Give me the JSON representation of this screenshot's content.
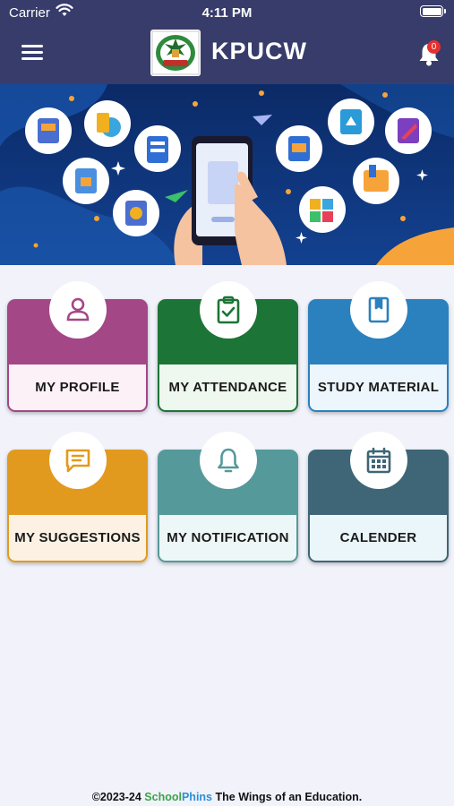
{
  "status_bar": {
    "carrier": "Carrier",
    "time": "4:11 PM"
  },
  "header": {
    "title": "KPUCW",
    "notification_count": "0",
    "menu_icon": "hamburger-menu-icon",
    "bell_icon": "bell-icon"
  },
  "colors": {
    "header_bg": "#373c6b",
    "banner_bg": "#0e2f6e",
    "page_bg": "#f1f2fa"
  },
  "tiles": [
    {
      "label": "MY PROFILE",
      "icon": "person-icon",
      "color": "#a34787",
      "light": "#fdf1f8"
    },
    {
      "label": "MY ATTENDANCE",
      "icon": "clipboard-check-icon",
      "color": "#1c7436",
      "light": "#eef8ee"
    },
    {
      "label": "STUDY MATERIAL",
      "icon": "book-icon",
      "color": "#2a81bd",
      "light": "#ecf6fc"
    },
    {
      "label": "MY SUGGESTIONS",
      "icon": "chat-icon",
      "color": "#e29a1e",
      "light": "#fdf1e4"
    },
    {
      "label": "MY NOTIFICATION",
      "icon": "bell-icon",
      "color": "#55999a",
      "light": "#eef7f7"
    },
    {
      "label": "CALENDER",
      "icon": "calendar-icon",
      "color": "#3e6676",
      "light": "#eaf6fa"
    }
  ],
  "footer": {
    "copyright": "©2023-24",
    "brand_school": "School",
    "brand_phins": "Phins",
    "tagline": "The Wings of an Education."
  }
}
